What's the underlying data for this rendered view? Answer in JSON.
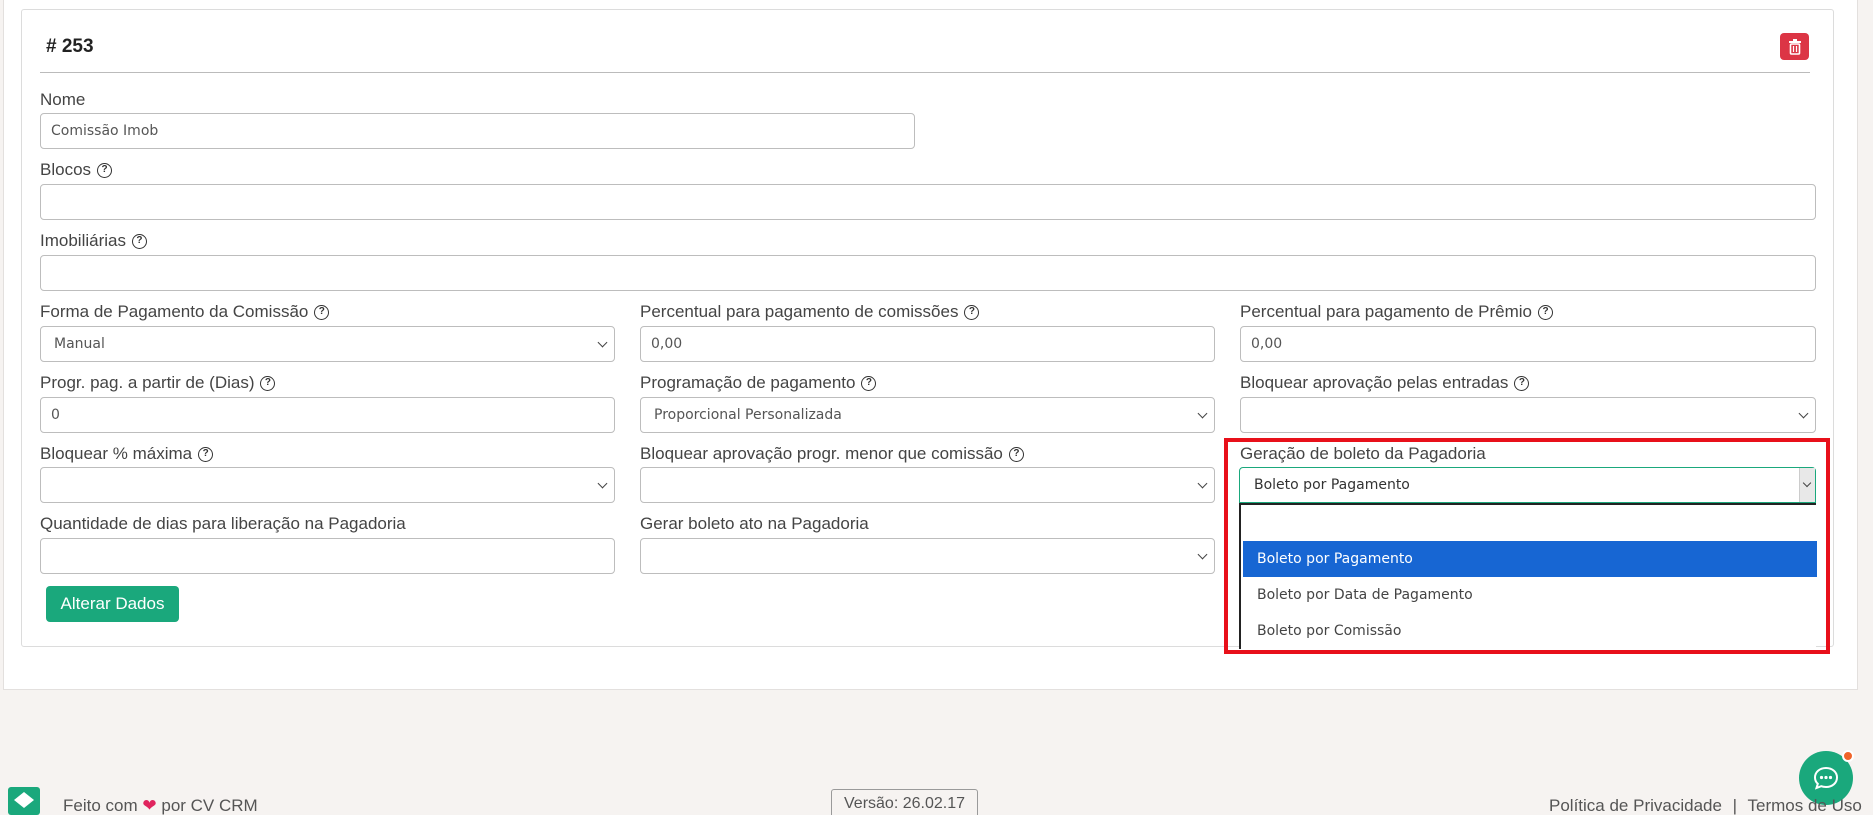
{
  "card": {
    "title": "# 253"
  },
  "fields": {
    "nome": {
      "label": "Nome",
      "value": "Comissão Imob"
    },
    "blocos": {
      "label": "Blocos",
      "value": ""
    },
    "imobiliarias": {
      "label": "Imobiliárias",
      "value": ""
    },
    "forma_pagamento": {
      "label": "Forma de Pagamento da Comissão",
      "value": "Manual"
    },
    "percentual_comissoes": {
      "label": "Percentual para pagamento de comissões",
      "value": "0,00"
    },
    "percentual_premio": {
      "label": "Percentual para pagamento de Prêmio",
      "value": "0,00"
    },
    "progr_dias": {
      "label": "Progr. pag. a partir de (Dias)",
      "value": "0"
    },
    "programacao_pagamento": {
      "label": "Programação de pagamento",
      "value": "Proporcional Personalizada"
    },
    "bloquear_aprovacao_entradas": {
      "label": "Bloquear aprovação pelas entradas",
      "value": ""
    },
    "bloquear_pct_maxima": {
      "label": "Bloquear % máxima",
      "value": ""
    },
    "bloquear_aprovacao_progr": {
      "label": "Bloquear aprovação progr. menor que comissão",
      "value": ""
    },
    "geracao_boleto": {
      "label": "Geração de boleto da Pagadoria",
      "value": "Boleto por Pagamento"
    },
    "qtd_dias_liberacao": {
      "label": "Quantidade de dias para liberação na Pagadoria",
      "value": ""
    },
    "gerar_boleto_ato": {
      "label": "Gerar boleto ato na Pagadoria",
      "value": ""
    }
  },
  "dropdown_options": [
    "",
    "Boleto por Pagamento",
    "Boleto por Data de Pagamento",
    "Boleto por Comissão"
  ],
  "dropdown_selected_index": 1,
  "buttons": {
    "alterar": "Alterar Dados"
  },
  "footer": {
    "made_with_prefix": "Feito com",
    "made_with_suffix": "por CV CRM",
    "version": "Versão: 26.02.17",
    "privacy": "Política de Privacidade",
    "separator": "|",
    "terms": "Termos de Uso"
  },
  "colors": {
    "accent_green": "#1aa87c",
    "danger_red": "#dc3545",
    "highlight_red": "#e8101a",
    "selected_blue": "#1766d3"
  },
  "help_icon_glyph": "?",
  "icons": [
    "trash-icon",
    "help-icon",
    "chevron-down-icon",
    "heart-icon",
    "chat-icon",
    "cvcrm-logo-icon"
  ]
}
